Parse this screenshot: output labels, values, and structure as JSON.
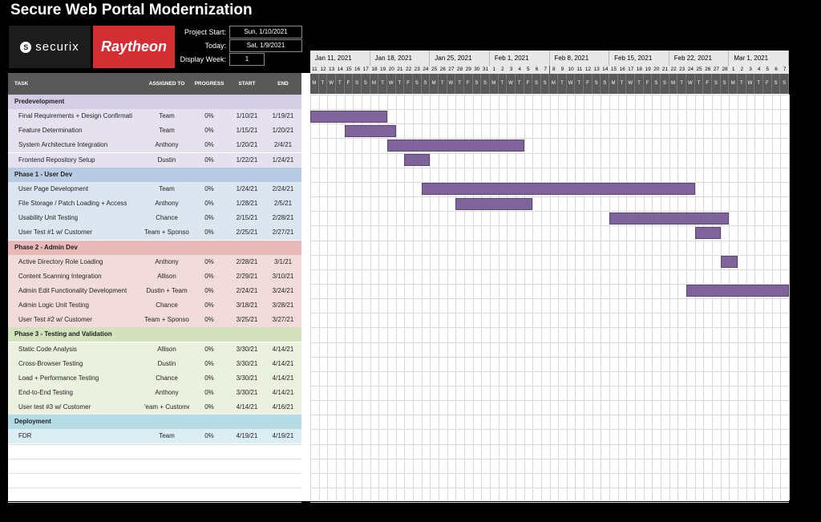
{
  "title": "Secure Web Portal Modernization",
  "logos": {
    "securix": "securix",
    "securix_mark": "S",
    "raytheon": "Raytheon"
  },
  "meta": {
    "project_start_label": "Project Start:",
    "project_start_value": "Sun, 1/10/2021",
    "today_label": "Today:",
    "today_value": "Sat, 1/9/2021",
    "display_week_label": "Display Week:",
    "display_week_value": "1"
  },
  "columns": {
    "task": "TASK",
    "assigned": "ASSIGNED TO",
    "progress": "PROGRESS",
    "start": "START",
    "end": "END"
  },
  "timeline": {
    "weeks": [
      "Jan 11, 2021",
      "Jan 18, 2021",
      "Jan 25, 2021",
      "Feb 1, 2021",
      "Feb 8, 2021",
      "Feb 15, 2021",
      "Feb 22, 2021",
      "Mar 1, 2021"
    ],
    "days": [
      "11",
      "12",
      "13",
      "14",
      "15",
      "16",
      "17",
      "18",
      "19",
      "20",
      "21",
      "22",
      "23",
      "24",
      "25",
      "26",
      "27",
      "28",
      "29",
      "30",
      "31",
      "1",
      "2",
      "3",
      "4",
      "5",
      "6",
      "7",
      "8",
      "9",
      "10",
      "11",
      "12",
      "13",
      "14",
      "15",
      "16",
      "17",
      "18",
      "19",
      "20",
      "21",
      "22",
      "23",
      "24",
      "25",
      "26",
      "27",
      "28",
      "1",
      "2",
      "3",
      "4",
      "5",
      "6",
      "7"
    ],
    "day_letters": [
      "M",
      "T",
      "W",
      "T",
      "F",
      "S",
      "S",
      "M",
      "T",
      "W",
      "T",
      "F",
      "S",
      "S",
      "M",
      "T",
      "W",
      "T",
      "F",
      "S",
      "S",
      "M",
      "T",
      "W",
      "T",
      "F",
      "S",
      "S",
      "M",
      "T",
      "W",
      "T",
      "F",
      "S",
      "S",
      "M",
      "T",
      "W",
      "T",
      "F",
      "S",
      "S",
      "M",
      "T",
      "W",
      "T",
      "F",
      "S",
      "S",
      "M",
      "T",
      "W",
      "T",
      "F",
      "S",
      "S"
    ]
  },
  "colors": {
    "phase0": "#d5cde3",
    "phase0_row": "#e6e1ee",
    "phase1": "#b9cbe2",
    "phase1_row": "#dce6f1",
    "phase2": "#e9b8b9",
    "phase2_row": "#f2dcdb",
    "phase3": "#d3e2bd",
    "phase3_row": "#ebf1de",
    "phase4": "#b7dbe5",
    "phase4_row": "#daeef3",
    "bar": "#7f649c"
  },
  "rows": [
    {
      "type": "phase",
      "label": "Predevelopment",
      "color": "phase0"
    },
    {
      "type": "task",
      "color": "phase0_row",
      "task": "Final Requirements + Design Confirmati",
      "assigned": "Team",
      "progress": "0%",
      "start": "1/10/21",
      "end": "1/19/21",
      "bar_start": -1,
      "bar_end": 8
    },
    {
      "type": "task",
      "color": "phase0_row",
      "task": "Feature Determination",
      "assigned": "Team",
      "progress": "0%",
      "start": "1/15/21",
      "end": "1/20/21",
      "bar_start": 4,
      "bar_end": 9
    },
    {
      "type": "task",
      "color": "phase0_row",
      "task": "System Architecture Integration",
      "assigned": "Anthony",
      "progress": "0%",
      "start": "1/20/21",
      "end": "2/4/21",
      "bar_start": 9,
      "bar_end": 24
    },
    {
      "type": "task",
      "color": "phase0_row",
      "task": "Frontend Repository Setup",
      "assigned": "Dustin",
      "progress": "0%",
      "start": "1/22/21",
      "end": "1/24/21",
      "bar_start": 11,
      "bar_end": 13
    },
    {
      "type": "phase",
      "label": "Phase 1 - User Dev",
      "color": "phase1"
    },
    {
      "type": "task",
      "color": "phase1_row",
      "task": "User Page Development",
      "assigned": "Team",
      "progress": "0%",
      "start": "1/24/21",
      "end": "2/24/21",
      "bar_start": 13,
      "bar_end": 44
    },
    {
      "type": "task",
      "color": "phase1_row",
      "task": "File Storage / Patch Loading + Access",
      "assigned": "Anthony",
      "progress": "0%",
      "start": "1/28/21",
      "end": "2/5/21",
      "bar_start": 17,
      "bar_end": 25
    },
    {
      "type": "task",
      "color": "phase1_row",
      "task": "Usability Unit Testing",
      "assigned": "Chance",
      "progress": "0%",
      "start": "2/15/21",
      "end": "2/28/21",
      "bar_start": 35,
      "bar_end": 48
    },
    {
      "type": "task",
      "color": "phase1_row",
      "task": "User Test #1 w/ Customer",
      "assigned": "Team + Sponsor",
      "progress": "0%",
      "start": "2/25/21",
      "end": "2/27/21",
      "bar_start": 45,
      "bar_end": 47
    },
    {
      "type": "phase",
      "label": "Phase 2 - Admin Dev",
      "color": "phase2"
    },
    {
      "type": "task",
      "color": "phase2_row",
      "task": "Active Directory Role Loading",
      "assigned": "Anthony",
      "progress": "0%",
      "start": "2/28/21",
      "end": "3/1/21",
      "bar_start": 48,
      "bar_end": 49
    },
    {
      "type": "task",
      "color": "phase2_row",
      "task": "Content Scanning Integration",
      "assigned": "Allison",
      "progress": "0%",
      "start": "2/29/21",
      "end": "3/10/21",
      "bar_start": null,
      "bar_end": null
    },
    {
      "type": "task",
      "color": "phase2_row",
      "task": "Admin Edit Functionality Development",
      "assigned": "Dustin + Team",
      "progress": "0%",
      "start": "2/24/21",
      "end": "3/24/21",
      "bar_start": 44,
      "bar_end": 56
    },
    {
      "type": "task",
      "color": "phase2_row",
      "task": "Admin Logic Unit Testing",
      "assigned": "Chance",
      "progress": "0%",
      "start": "3/18/21",
      "end": "3/28/21",
      "bar_start": null,
      "bar_end": null
    },
    {
      "type": "task",
      "color": "phase2_row",
      "task": "User Test #2 w/ Customer",
      "assigned": "Team + Sponsor",
      "progress": "0%",
      "start": "3/25/21",
      "end": "3/27/21",
      "bar_start": null,
      "bar_end": null
    },
    {
      "type": "phase",
      "label": "Phase 3 - Testing and Validation",
      "color": "phase3"
    },
    {
      "type": "task",
      "color": "phase3_row",
      "task": "Static Code Analysis",
      "assigned": "Allison",
      "progress": "0%",
      "start": "3/30/21",
      "end": "4/14/21",
      "bar_start": null,
      "bar_end": null
    },
    {
      "type": "task",
      "color": "phase3_row",
      "task": "Cross-Browser Testing",
      "assigned": "Dustin",
      "progress": "0%",
      "start": "3/30/21",
      "end": "4/14/21",
      "bar_start": null,
      "bar_end": null
    },
    {
      "type": "task",
      "color": "phase3_row",
      "task": "Load + Performance Testing",
      "assigned": "Chance",
      "progress": "0%",
      "start": "3/30/21",
      "end": "4/14/21",
      "bar_start": null,
      "bar_end": null
    },
    {
      "type": "task",
      "color": "phase3_row",
      "task": "End-to-End Testing",
      "assigned": "Anthony",
      "progress": "0%",
      "start": "3/30/21",
      "end": "4/14/21",
      "bar_start": null,
      "bar_end": null
    },
    {
      "type": "task",
      "color": "phase3_row",
      "task": "User test #3 w/ Customer",
      "assigned": "'eam + Custome",
      "progress": "0%",
      "start": "4/14/21",
      "end": "4/16/21",
      "bar_start": null,
      "bar_end": null
    },
    {
      "type": "phase",
      "label": "Deployment",
      "color": "phase4"
    },
    {
      "type": "task",
      "color": "phase4_row",
      "task": "FDR",
      "assigned": "Team",
      "progress": "0%",
      "start": "4/19/21",
      "end": "4/19/21",
      "bar_start": null,
      "bar_end": null
    }
  ]
}
